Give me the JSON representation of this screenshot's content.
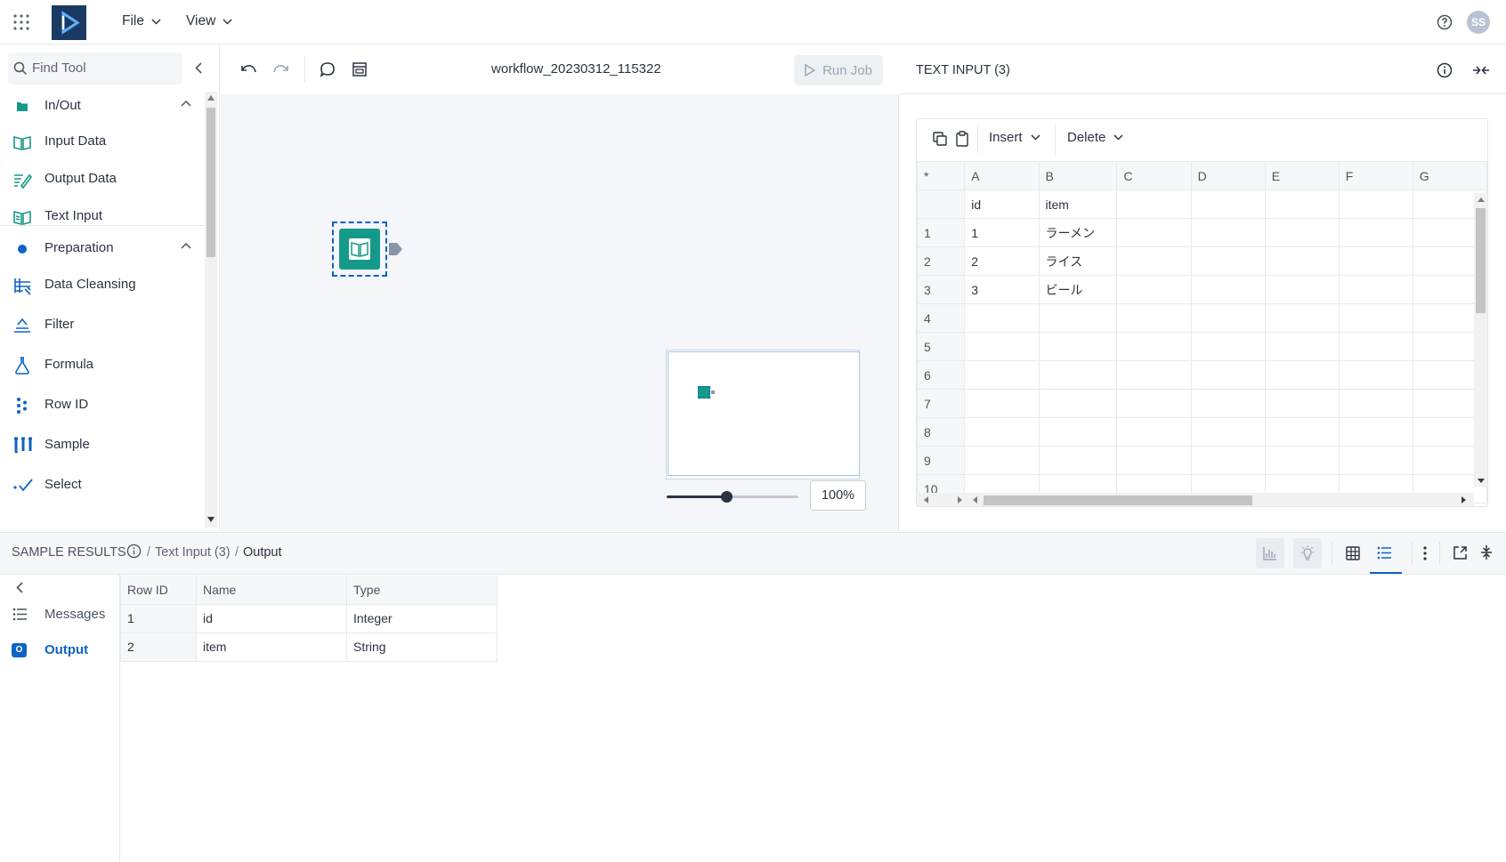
{
  "topbar": {
    "menu_file": "File",
    "menu_view": "View",
    "avatar_initials": "SS"
  },
  "toolpanel": {
    "search_placeholder": "Find Tool",
    "categories": [
      {
        "label": "In/Out",
        "items": [
          "Input Data",
          "Output Data",
          "Text Input"
        ]
      },
      {
        "label": "Preparation",
        "items": [
          "Data Cleansing",
          "Filter",
          "Formula",
          "Row ID",
          "Sample",
          "Select"
        ]
      }
    ]
  },
  "canvas": {
    "workflow_name": "workflow_20230312_115322",
    "run_job_label": "Run Job",
    "zoom_label": "100%",
    "zoom_level": 0.45
  },
  "config": {
    "title": "TEXT INPUT (3)",
    "insert_label": "Insert",
    "delete_label": "Delete",
    "corner_label": "*",
    "columns": [
      "A",
      "B",
      "C",
      "D",
      "E",
      "F",
      "G"
    ],
    "header_row": [
      "id",
      "item",
      "",
      "",
      "",
      "",
      ""
    ],
    "rows": [
      {
        "n": "1",
        "cells": [
          "1",
          "ラーメン",
          "",
          "",
          "",
          "",
          ""
        ]
      },
      {
        "n": "2",
        "cells": [
          "2",
          "ライス",
          "",
          "",
          "",
          "",
          ""
        ]
      },
      {
        "n": "3",
        "cells": [
          "3",
          "ビール",
          "",
          "",
          "",
          "",
          ""
        ]
      },
      {
        "n": "4",
        "cells": [
          "",
          "",
          "",
          "",
          "",
          "",
          ""
        ]
      },
      {
        "n": "5",
        "cells": [
          "",
          "",
          "",
          "",
          "",
          "",
          ""
        ]
      },
      {
        "n": "6",
        "cells": [
          "",
          "",
          "",
          "",
          "",
          "",
          ""
        ]
      },
      {
        "n": "7",
        "cells": [
          "",
          "",
          "",
          "",
          "",
          "",
          ""
        ]
      },
      {
        "n": "8",
        "cells": [
          "",
          "",
          "",
          "",
          "",
          "",
          ""
        ]
      },
      {
        "n": "9",
        "cells": [
          "",
          "",
          "",
          "",
          "",
          "",
          ""
        ]
      },
      {
        "n": "10",
        "cells": [
          "",
          "",
          "",
          "",
          "",
          "",
          ""
        ]
      }
    ]
  },
  "results": {
    "title": "SAMPLE RESULTS",
    "breadcrumb_sep": "/",
    "breadcrumb_tool": "Text Input (3)",
    "breadcrumb_current": "Output",
    "nav": [
      {
        "label": "Messages"
      },
      {
        "label": "Output"
      }
    ],
    "columns": [
      "Row ID",
      "Name",
      "Type"
    ],
    "rows": [
      [
        "1",
        "id",
        "Integer"
      ],
      [
        "2",
        "item",
        "String"
      ]
    ]
  },
  "colors": {
    "accent": "#0d63c4",
    "tool_teal": "#159a8a",
    "brand_navy": "#1b3a63"
  }
}
